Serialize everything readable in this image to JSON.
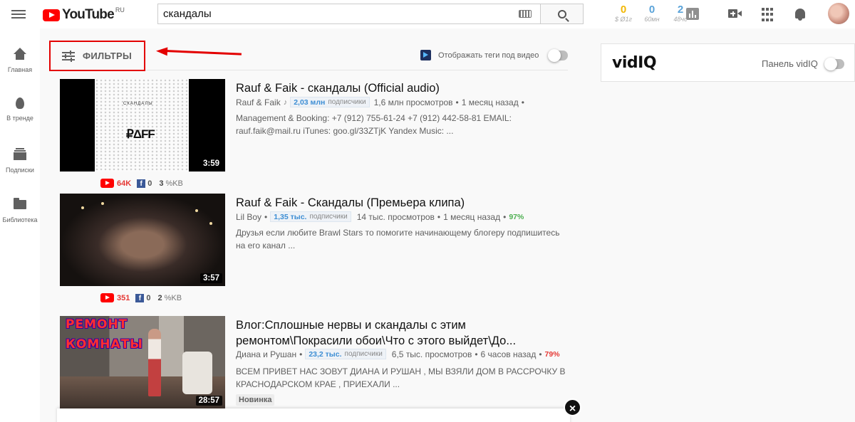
{
  "header": {
    "logo_text": "YouTube",
    "logo_region": "RU",
    "search_value": "скандалы",
    "stats": [
      {
        "value": "0",
        "label": "$ Ø1г",
        "color": "#f2b705"
      },
      {
        "value": "0",
        "label": "60мн",
        "color": "#5aa3d9"
      },
      {
        "value": "2",
        "label": "48чс",
        "color": "#5aa3d9"
      }
    ]
  },
  "sidebar": {
    "items": [
      {
        "label": "Главная",
        "icon": "home-icon"
      },
      {
        "label": "В тренде",
        "icon": "fire-icon"
      },
      {
        "label": "Подписки",
        "icon": "subscriptions-icon"
      },
      {
        "label": "Библиотека",
        "icon": "library-icon"
      }
    ]
  },
  "filters": {
    "label": "ФИЛЬТРЫ",
    "show_tags_label": "Отображать теги под видео"
  },
  "vidiq": {
    "logo": "vidIQ",
    "panel_label": "Панель vidIQ"
  },
  "colors": {
    "accent_red": "#ff0000",
    "annotation_red": "#e30000",
    "subs_blue": "#3d8ed4",
    "pct_green": "#4caf50",
    "pct_red": "#e53935"
  },
  "videos": [
    {
      "title": "Rauf & Faik - скандалы (Official audio)",
      "channel": "Rauf & Faik",
      "channel_icon": "music-note-icon",
      "subs_value": "2,03 млн",
      "subs_label": "подписчики",
      "views": "1,6 млн просмотров",
      "age": "1 месяц назад",
      "desc": "Management & Booking: +7 (912) 755-61-24 +7 (912) 442-58-81 EMAIL: rauf.faik@mail.ru iTunes: goo.gl/33ZTjK Yandex Music: ...",
      "duration": "3:59",
      "yt_count": "64K",
      "fb_count": "0",
      "kb_count": "3",
      "kb_unit": "%KB",
      "thumb_header": "СКАНДАЛЫ",
      "thumb_logo": "₽ΔFF"
    },
    {
      "title": "Rauf & Faik - Скандалы (Премьера клипа)",
      "channel": "Lil Boy",
      "subs_value": "1,35 тыс.",
      "subs_label": "подписчики",
      "views": "14 тыс. просмотров",
      "age": "1 месяц назад",
      "pct": "97%",
      "desc": "Друзья если любите Brawl Stars то помогите начинающему блогеру подпишитесь на его канал  ...",
      "duration": "3:57",
      "yt_count": "351",
      "fb_count": "0",
      "kb_count": "2",
      "kb_unit": "%KB"
    },
    {
      "title": "Влог:Сплошные нервы и скандалы с этим ремонтом\\Покрасили обои\\Что с этого выйдет\\До...",
      "channel": "Диана и Рушан",
      "subs_value": "23,2 тыс.",
      "subs_label": "подписчики",
      "views": "6,5 тыс. просмотров",
      "age": "6 часов назад",
      "pct": "79%",
      "desc": "ВСЕМ ПРИВЕТ НАС ЗОВУТ ДИАНА И РУШАН , МЫ ВЗЯЛИ ДОМ В РАССРОЧКУ В КРАСНОДАРСКОМ КРАЕ , ПРИЕХАЛИ ...",
      "duration": "28:57",
      "badge": "Новинка",
      "thumb_text_1": "РЕМОНТ",
      "thumb_text_2": "КОМНАТЫ"
    }
  ],
  "popup": {
    "close_glyph": "×"
  }
}
